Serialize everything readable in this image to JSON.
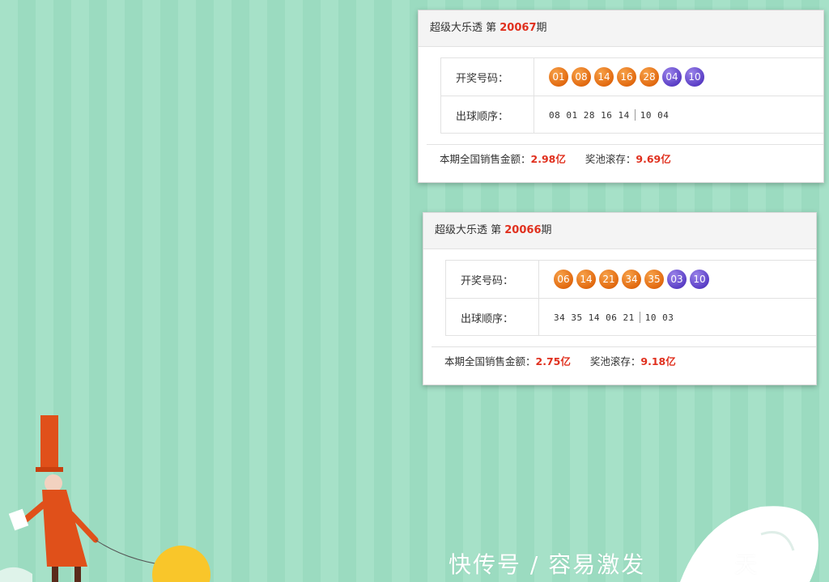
{
  "draws": [
    {
      "header_prefix": "超级大乐透 第 ",
      "issue": "20067",
      "header_suffix": "期",
      "numbers_label": "开奖号码：",
      "red_balls": [
        "01",
        "08",
        "14",
        "16",
        "28"
      ],
      "blue_balls": [
        "04",
        "10"
      ],
      "order_label": "出球顺序：",
      "order_front": "08 01 28 16 14",
      "order_back": "10 04",
      "sales_label": "本期全国销售金额：",
      "sales_value": "2.98亿",
      "pool_label": "奖池滚存：",
      "pool_value": "9.69亿"
    },
    {
      "header_prefix": "超级大乐透 第 ",
      "issue": "20066",
      "header_suffix": "期",
      "numbers_label": "开奖号码：",
      "red_balls": [
        "06",
        "14",
        "21",
        "34",
        "35"
      ],
      "blue_balls": [
        "03",
        "10"
      ],
      "order_label": "出球顺序：",
      "order_front": "34 35 14 06 21",
      "order_back": "10 03",
      "sales_label": "本期全国销售金额：",
      "sales_value": "2.75亿",
      "pool_label": "奖池滚存：",
      "pool_value": "9.18亿"
    }
  ],
  "watermark": "快传号 / 容易激发",
  "watermark_tail": "天",
  "colors": {
    "red_ball": "#e26a10",
    "blue_ball": "#5b3fc6",
    "accent": "#e0301e",
    "background": "#a6e1c8"
  }
}
